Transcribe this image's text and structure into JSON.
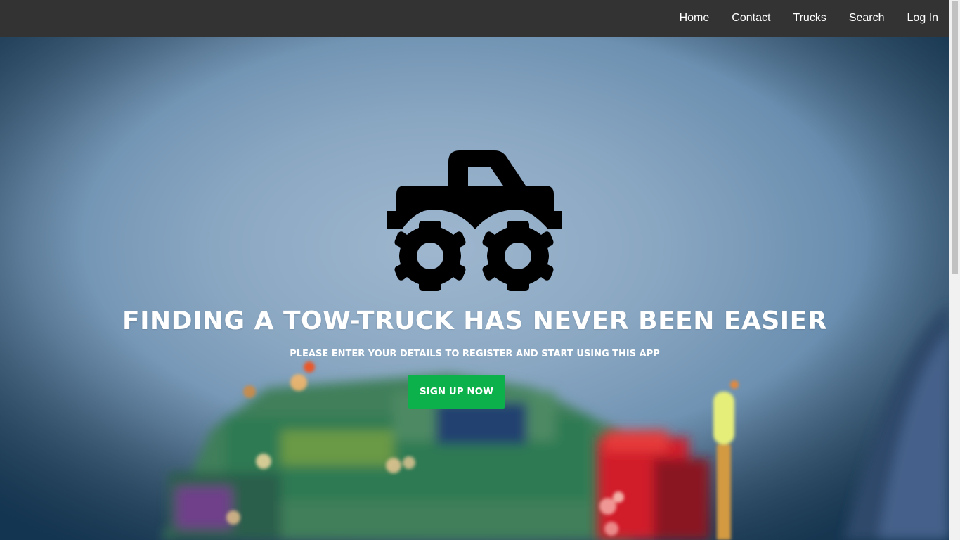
{
  "nav": {
    "items": [
      {
        "label": "Home"
      },
      {
        "label": "Contact"
      },
      {
        "label": "Trucks"
      },
      {
        "label": "Search"
      },
      {
        "label": "Log In"
      }
    ]
  },
  "hero": {
    "icon": "monster-truck-icon",
    "title": "FINDING A TOW-TRUCK HAS NEVER BEEN EASIER",
    "subtitle": "PLEASE ENTER YOUR DETAILS TO REGISTER AND START USING THIS APP",
    "cta_label": "SIGN UP NOW"
  },
  "colors": {
    "navbar_bg": "#333333",
    "nav_text": "#ffffff",
    "cta_bg": "#0db14b",
    "hero_text": "#ffffff"
  }
}
